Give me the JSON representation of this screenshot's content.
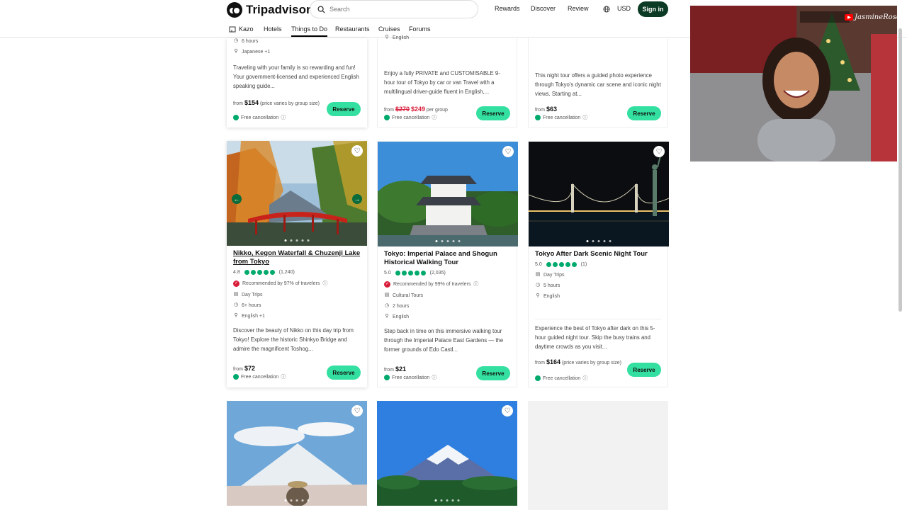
{
  "header": {
    "logo_text": "Tripadvisor",
    "search_placeholder": "Search",
    "links": [
      "Rewards",
      "Discover",
      "Review"
    ],
    "currency": "USD",
    "signin": "Sign in"
  },
  "subnav": {
    "location": "Kazo",
    "items": [
      "Hotels",
      "Things to Do",
      "Restaurants",
      "Cruises",
      "Forums"
    ],
    "active": "Things to Do"
  },
  "top_row": [
    {
      "duration": "6 hours",
      "language": "Japanese +1",
      "desc": "Traveling with your family is so rewarding and fun! Your government-licensed and experienced English speaking guide...",
      "from": "from",
      "price": "$154",
      "price_note": "(price varies by group size)",
      "free_cancellation": "Free cancellation",
      "reserve": "Reserve"
    },
    {
      "language": "English",
      "desc": "Enjoy a fully PRIVATE and CUSTOMISABLE 9-hour tour of Tokyo by car or van Travel with a multilingual driver-guide fluent in English,...",
      "from": "from",
      "old_price": "$270",
      "price": "$249",
      "price_note": "per group",
      "free_cancellation": "Free cancellation",
      "reserve": "Reserve"
    },
    {
      "desc": "This night tour offers a guided photo experience through Tokyo's dynamic car scene and iconic night views. Starting at...",
      "from": "from",
      "price": "$63",
      "free_cancellation": "Free cancellation",
      "reserve": "Reserve"
    }
  ],
  "mid_row": [
    {
      "title": "Nikko, Kegon Waterfall & Chuzenji Lake from Tokyo",
      "rating": "4.8",
      "reviews": "(1,240)",
      "recommended": "Recommended by 97% of travelers",
      "category": "Day Trips",
      "duration": "6+ hours",
      "language": "English +1",
      "desc": "Discover the beauty of Nikko on this day trip from Tokyo! Explore the historic Shinkyo Bridge and admire the magnificent Toshog...",
      "from": "from",
      "price": "$72",
      "free_cancellation": "Free cancellation",
      "reserve": "Reserve"
    },
    {
      "title": "Tokyo: Imperial Palace and Shogun Historical Walking Tour",
      "rating": "5.0",
      "reviews": "(2,035)",
      "recommended": "Recommended by 99% of travelers",
      "category": "Cultural Tours",
      "duration": "2 hours",
      "language": "English",
      "desc": "Step back in time on this immersive walking tour through the Imperial Palace East Gardens — the former grounds of Edo Castl...",
      "from": "from",
      "price": "$21",
      "free_cancellation": "Free cancellation",
      "reserve": "Reserve"
    },
    {
      "title": "Tokyo After Dark Scenic Night Tour",
      "rating": "5.0",
      "reviews": "(1)",
      "category": "Day Trips",
      "duration": "5 hours",
      "language": "English",
      "desc": "Experience the best of Tokyo after dark on this 5-hour guided night tour. Skip the busy trains and daytime crowds as you visit...",
      "from": "from",
      "price": "$164",
      "price_note": "(price varies by group size)",
      "free_cancellation": "Free cancellation",
      "reserve": "Reserve"
    }
  ],
  "webcam": {
    "channel": "JasmineRosexo"
  },
  "colors": {
    "brand": "#0b3b24",
    "reserve": "#34e0a1",
    "bubble": "#00aa6c",
    "sale": "#d91e3a"
  }
}
